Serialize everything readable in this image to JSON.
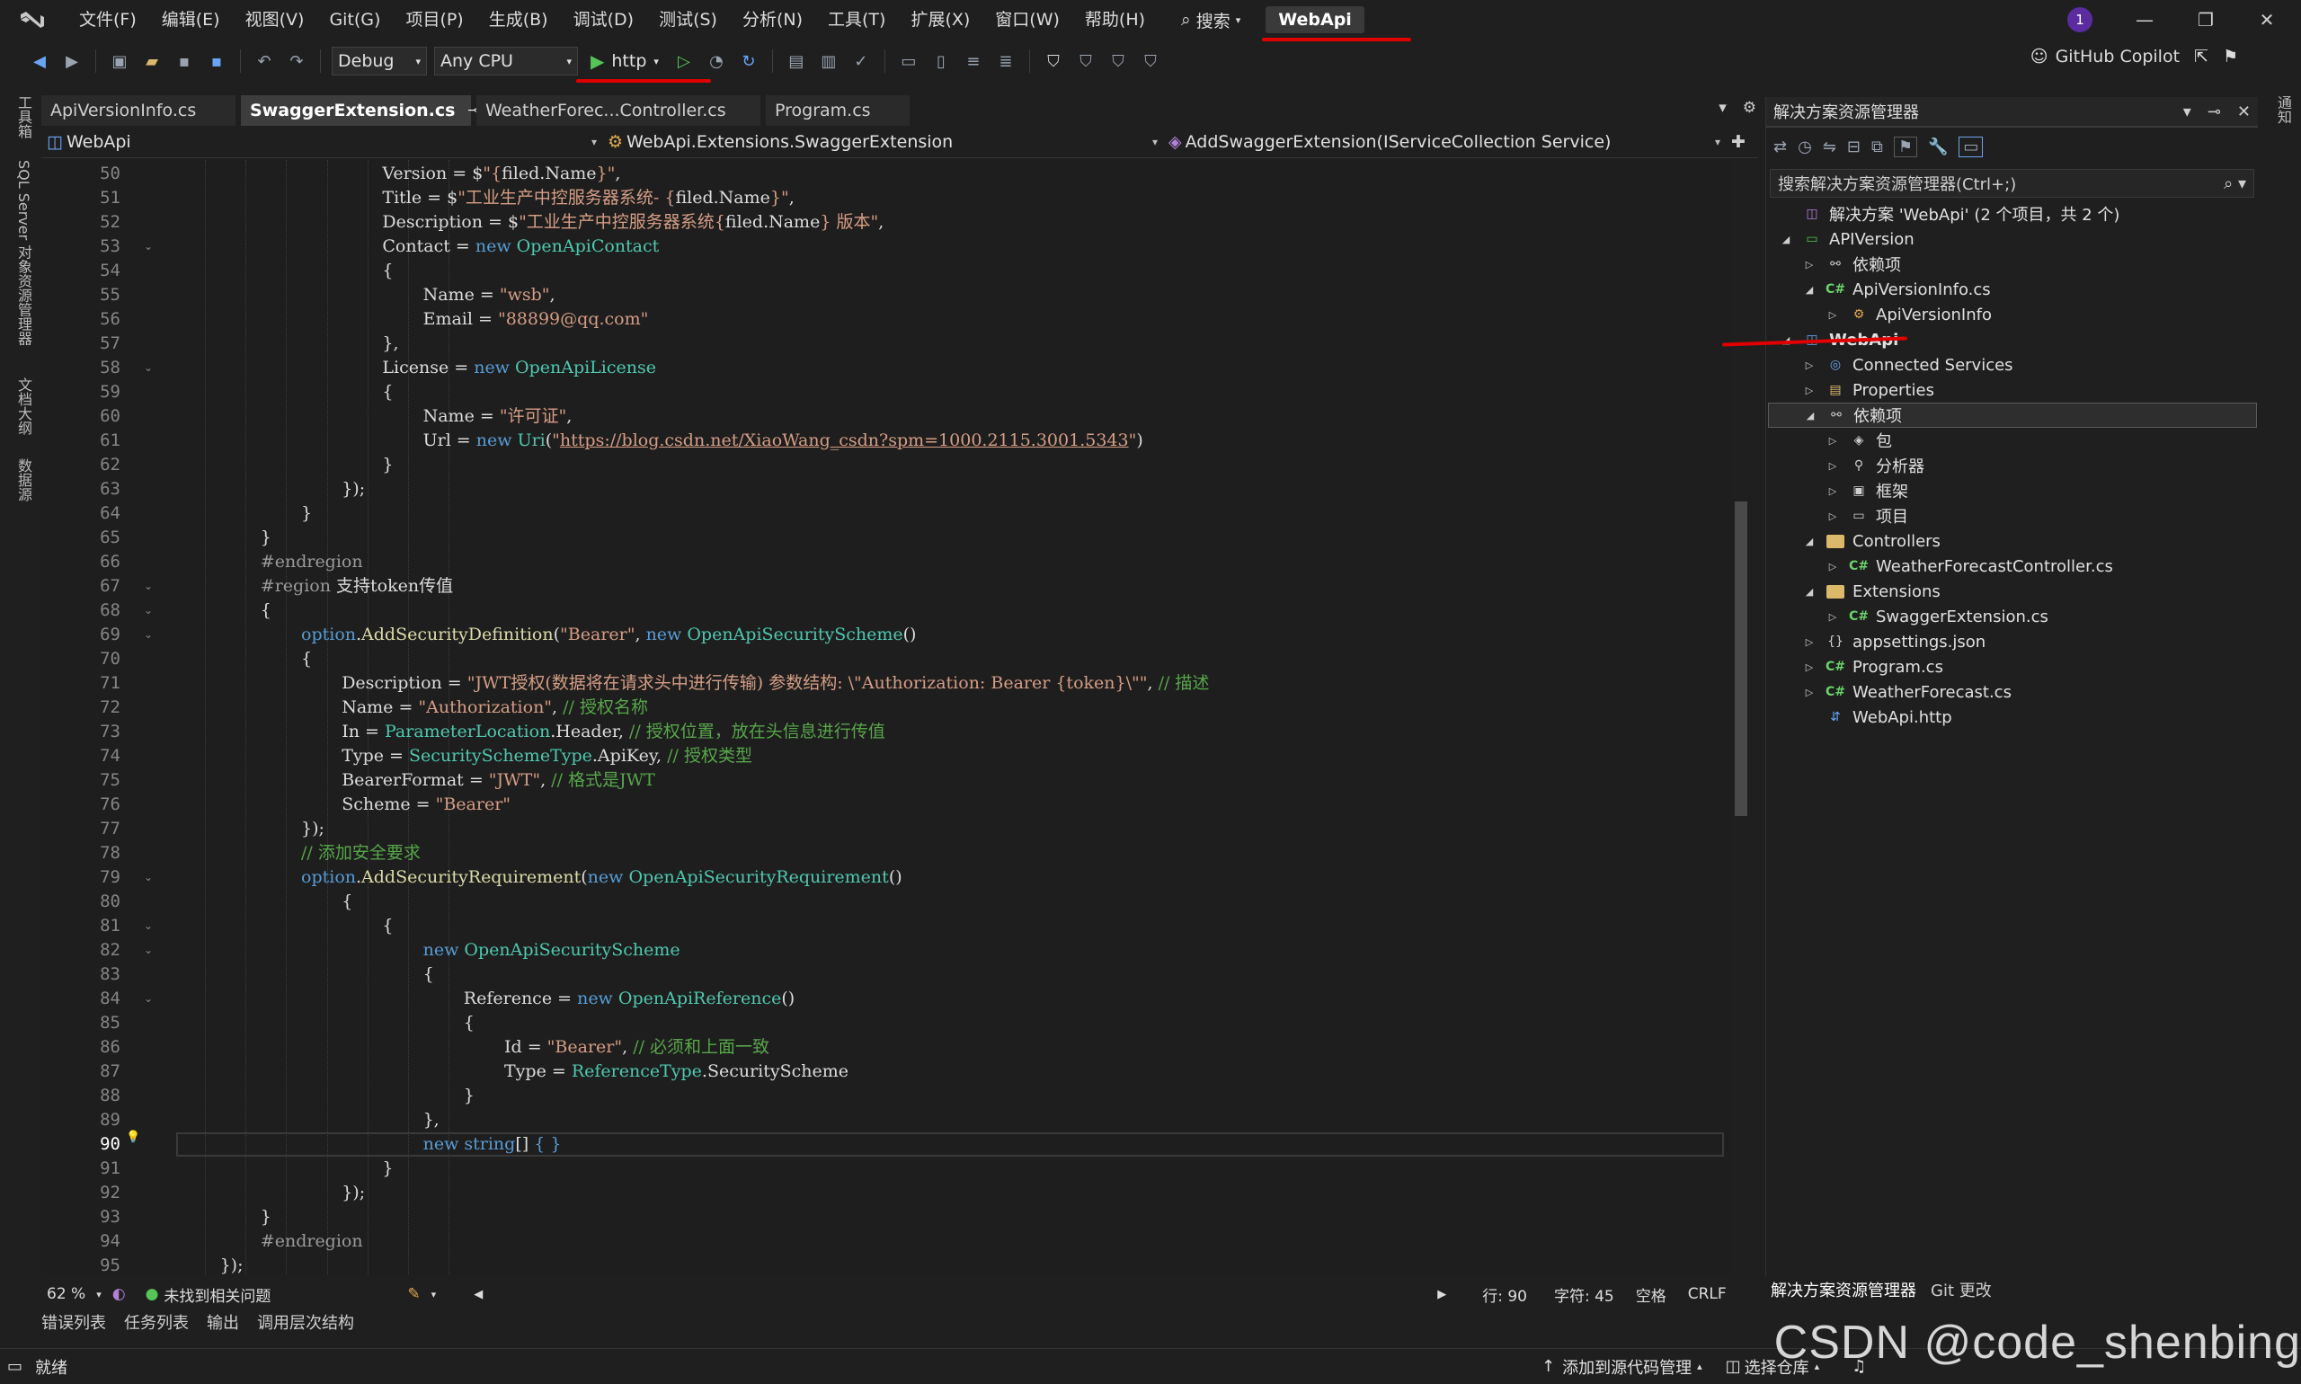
{
  "menu": {
    "items": [
      "文件(F)",
      "编辑(E)",
      "视图(V)",
      "Git(G)",
      "项目(P)",
      "生成(B)",
      "调试(D)",
      "测试(S)",
      "分析(N)",
      "工具(T)",
      "扩展(X)",
      "窗口(W)",
      "帮助(H)"
    ],
    "search_label": "搜索",
    "solution_title": "WebApi",
    "notification_count": "1"
  },
  "toolbar": {
    "config": "Debug",
    "platform": "Any CPU",
    "run_profile": "http",
    "copilot_label": "GitHub Copilot"
  },
  "left_strip": {
    "tabs": [
      "工具箱",
      "SQL Server 对象资源管理器",
      "文档大纲",
      "数据源"
    ]
  },
  "editor": {
    "tabs": [
      "ApiVersionInfo.cs",
      "SwaggerExtension.cs",
      "WeatherForec...Controller.cs",
      "Program.cs"
    ],
    "active_tab": 1,
    "nav": {
      "project": "WebApi",
      "type": "WebApi.Extensions.SwaggerExtension",
      "member": "AddSwaggerExtension(IServiceCollection Service)"
    },
    "current_line": 90,
    "lines": [
      {
        "n": 50,
        "indent": 9,
        "fold": false,
        "parts": [
          [
            "op",
            "Version = $"
          ],
          [
            "st",
            "\"{"
          ],
          [
            "op",
            "filed.Name"
          ],
          [
            "st",
            "}\""
          ],
          [
            "op",
            ","
          ]
        ]
      },
      {
        "n": 51,
        "indent": 9,
        "fold": false,
        "parts": [
          [
            "op",
            "Title = $"
          ],
          [
            "st",
            "\"工业生产中控服务器系统- {"
          ],
          [
            "op",
            "filed.Name"
          ],
          [
            "st",
            "}\""
          ],
          [
            "op",
            ","
          ]
        ]
      },
      {
        "n": 52,
        "indent": 9,
        "fold": false,
        "parts": [
          [
            "op",
            "Description = $"
          ],
          [
            "st",
            "\"工业生产中控服务器系统{"
          ],
          [
            "op",
            "filed.Name"
          ],
          [
            "st",
            "} 版本\""
          ],
          [
            "op",
            ","
          ]
        ]
      },
      {
        "n": 53,
        "indent": 9,
        "fold": true,
        "parts": [
          [
            "op",
            "Contact = "
          ],
          [
            "kw",
            "new "
          ],
          [
            "ty",
            "OpenApiContact"
          ]
        ]
      },
      {
        "n": 54,
        "indent": 9,
        "fold": false,
        "parts": [
          [
            "op",
            "{"
          ]
        ]
      },
      {
        "n": 55,
        "indent": 11,
        "fold": false,
        "parts": [
          [
            "op",
            "Name = "
          ],
          [
            "st",
            "\"wsb\""
          ],
          [
            "op",
            ","
          ]
        ]
      },
      {
        "n": 56,
        "indent": 11,
        "fold": false,
        "parts": [
          [
            "op",
            "Email = "
          ],
          [
            "st",
            "\"88899@qq.com\""
          ]
        ]
      },
      {
        "n": 57,
        "indent": 9,
        "fold": false,
        "parts": [
          [
            "op",
            "},"
          ]
        ]
      },
      {
        "n": 58,
        "indent": 9,
        "fold": true,
        "parts": [
          [
            "op",
            "License = "
          ],
          [
            "kw",
            "new "
          ],
          [
            "ty",
            "OpenApiLicense"
          ]
        ]
      },
      {
        "n": 59,
        "indent": 9,
        "fold": false,
        "parts": [
          [
            "op",
            "{"
          ]
        ]
      },
      {
        "n": 60,
        "indent": 11,
        "fold": false,
        "parts": [
          [
            "op",
            "Name = "
          ],
          [
            "st",
            "\"许可证\""
          ],
          [
            "op",
            ","
          ]
        ]
      },
      {
        "n": 61,
        "indent": 11,
        "fold": false,
        "parts": [
          [
            "op",
            "Url = "
          ],
          [
            "kw",
            "new "
          ],
          [
            "ty",
            "Uri"
          ],
          [
            "op",
            "("
          ],
          [
            "st",
            "\""
          ],
          [
            "lk",
            "https://blog.csdn.net/XiaoWang_csdn?spm=1000.2115.3001.5343"
          ],
          [
            "st",
            "\""
          ],
          [
            "op",
            ")"
          ]
        ]
      },
      {
        "n": 62,
        "indent": 9,
        "fold": false,
        "parts": [
          [
            "op",
            "}"
          ]
        ]
      },
      {
        "n": 63,
        "indent": 7,
        "fold": false,
        "parts": [
          [
            "op",
            "});"
          ]
        ]
      },
      {
        "n": 64,
        "indent": 5,
        "fold": false,
        "parts": [
          [
            "op",
            "}"
          ]
        ]
      },
      {
        "n": 65,
        "indent": 3,
        "fold": false,
        "parts": [
          [
            "op",
            "}"
          ]
        ]
      },
      {
        "n": 66,
        "indent": 3,
        "fold": false,
        "parts": [
          [
            "pp",
            "#endregion"
          ]
        ]
      },
      {
        "n": 67,
        "indent": 3,
        "fold": true,
        "parts": [
          [
            "pp",
            "#region "
          ],
          [
            "op",
            "支持token传值"
          ]
        ]
      },
      {
        "n": 68,
        "indent": 3,
        "fold": true,
        "parts": [
          [
            "op",
            "{"
          ]
        ]
      },
      {
        "n": 69,
        "indent": 5,
        "fold": true,
        "parts": [
          [
            "kw",
            "option"
          ],
          [
            "op",
            "."
          ],
          [
            "mt",
            "AddSecurityDefinition"
          ],
          [
            "op",
            "("
          ],
          [
            "st",
            "\"Bearer\""
          ],
          [
            "op",
            ", "
          ],
          [
            "kw",
            "new "
          ],
          [
            "ty",
            "OpenApiSecurityScheme"
          ],
          [
            "op",
            "()"
          ]
        ]
      },
      {
        "n": 70,
        "indent": 5,
        "fold": false,
        "parts": [
          [
            "op",
            "{"
          ]
        ]
      },
      {
        "n": 71,
        "indent": 7,
        "fold": false,
        "parts": [
          [
            "op",
            "Description = "
          ],
          [
            "st",
            "\"JWT授权(数据将在请求头中进行传输) 参数结构: \\\"Authorization: Bearer {token}\\\"\""
          ],
          [
            "op",
            ", "
          ],
          [
            "cm",
            "// 描述"
          ]
        ]
      },
      {
        "n": 72,
        "indent": 7,
        "fold": false,
        "parts": [
          [
            "op",
            "Name = "
          ],
          [
            "st",
            "\"Authorization\""
          ],
          [
            "op",
            ", "
          ],
          [
            "cm",
            "// 授权名称"
          ]
        ]
      },
      {
        "n": 73,
        "indent": 7,
        "fold": false,
        "parts": [
          [
            "op",
            "In = "
          ],
          [
            "ty",
            "ParameterLocation"
          ],
          [
            "op",
            ".Header, "
          ],
          [
            "cm",
            "// 授权位置，放在头信息进行传值"
          ]
        ]
      },
      {
        "n": 74,
        "indent": 7,
        "fold": false,
        "parts": [
          [
            "op",
            "Type = "
          ],
          [
            "ty",
            "SecuritySchemeType"
          ],
          [
            "op",
            ".ApiKey, "
          ],
          [
            "cm",
            "// 授权类型"
          ]
        ]
      },
      {
        "n": 75,
        "indent": 7,
        "fold": false,
        "parts": [
          [
            "op",
            "BearerFormat = "
          ],
          [
            "st",
            "\"JWT\""
          ],
          [
            "op",
            ", "
          ],
          [
            "cm",
            "// 格式是JWT"
          ]
        ]
      },
      {
        "n": 76,
        "indent": 7,
        "fold": false,
        "parts": [
          [
            "op",
            "Scheme = "
          ],
          [
            "st",
            "\"Bearer\""
          ]
        ]
      },
      {
        "n": 77,
        "indent": 5,
        "fold": false,
        "parts": [
          [
            "op",
            "});"
          ]
        ]
      },
      {
        "n": 78,
        "indent": 5,
        "fold": false,
        "parts": [
          [
            "cm",
            "// 添加安全要求"
          ]
        ]
      },
      {
        "n": 79,
        "indent": 5,
        "fold": true,
        "parts": [
          [
            "kw",
            "option"
          ],
          [
            "op",
            "."
          ],
          [
            "mt",
            "AddSecurityRequirement"
          ],
          [
            "op",
            "("
          ],
          [
            "kw",
            "new "
          ],
          [
            "ty",
            "OpenApiSecurityRequirement"
          ],
          [
            "op",
            "()"
          ]
        ]
      },
      {
        "n": 80,
        "indent": 7,
        "fold": false,
        "parts": [
          [
            "op",
            "{"
          ]
        ]
      },
      {
        "n": 81,
        "indent": 9,
        "fold": true,
        "parts": [
          [
            "op",
            "{"
          ]
        ]
      },
      {
        "n": 82,
        "indent": 11,
        "fold": true,
        "parts": [
          [
            "kw",
            "new "
          ],
          [
            "ty",
            "OpenApiSecurityScheme"
          ]
        ]
      },
      {
        "n": 83,
        "indent": 11,
        "fold": false,
        "parts": [
          [
            "op",
            "{"
          ]
        ]
      },
      {
        "n": 84,
        "indent": 13,
        "fold": true,
        "parts": [
          [
            "op",
            "Reference = "
          ],
          [
            "kw",
            "new "
          ],
          [
            "ty",
            "OpenApiReference"
          ],
          [
            "op",
            "()"
          ]
        ]
      },
      {
        "n": 85,
        "indent": 13,
        "fold": false,
        "parts": [
          [
            "op",
            "{"
          ]
        ]
      },
      {
        "n": 86,
        "indent": 15,
        "fold": false,
        "parts": [
          [
            "op",
            "Id = "
          ],
          [
            "st",
            "\"Bearer\""
          ],
          [
            "op",
            ", "
          ],
          [
            "cm",
            "// 必须和上面一致"
          ]
        ]
      },
      {
        "n": 87,
        "indent": 15,
        "fold": false,
        "parts": [
          [
            "op",
            "Type = "
          ],
          [
            "ty",
            "ReferenceType"
          ],
          [
            "op",
            ".SecurityScheme"
          ]
        ]
      },
      {
        "n": 88,
        "indent": 13,
        "fold": false,
        "parts": [
          [
            "op",
            "}"
          ]
        ]
      },
      {
        "n": 89,
        "indent": 11,
        "fold": false,
        "parts": [
          [
            "op",
            "},"
          ]
        ]
      },
      {
        "n": 90,
        "indent": 11,
        "fold": false,
        "parts": [
          [
            "kw",
            "new "
          ],
          [
            "kw",
            "string"
          ],
          [
            "op",
            "[] "
          ],
          [
            "kw",
            "{ }"
          ]
        ]
      },
      {
        "n": 91,
        "indent": 9,
        "fold": false,
        "parts": [
          [
            "op",
            "}"
          ]
        ]
      },
      {
        "n": 92,
        "indent": 7,
        "fold": false,
        "parts": [
          [
            "op",
            "});"
          ]
        ]
      },
      {
        "n": 93,
        "indent": 3,
        "fold": false,
        "parts": [
          [
            "op",
            "}"
          ]
        ]
      },
      {
        "n": 94,
        "indent": 3,
        "fold": false,
        "parts": [
          [
            "pp",
            "#endregion"
          ]
        ]
      },
      {
        "n": 95,
        "indent": 1,
        "fold": false,
        "parts": [
          [
            "op",
            "});"
          ]
        ]
      }
    ],
    "status": {
      "zoom": "62 %",
      "issues": "未找到相关问题",
      "line": "行: 90",
      "char": "字符: 45",
      "whitespace": "空格",
      "eol": "CRLF"
    }
  },
  "bottom_tabs": [
    "错误列表",
    "任务列表",
    "输出",
    "调用层次结构"
  ],
  "solution_explorer": {
    "title": "解决方案资源管理器",
    "search_placeholder": "搜索解决方案资源管理器(Ctrl+;)",
    "tree": [
      {
        "label": "解决方案 'WebApi' (2 个项目，共 2 个)",
        "level": 0,
        "arrow": "",
        "icon": "solution"
      },
      {
        "label": "APIVersion",
        "level": 0,
        "arrow": "open",
        "icon": "project"
      },
      {
        "label": "依赖项",
        "level": 1,
        "arrow": "closed",
        "icon": "deps"
      },
      {
        "label": "ApiVersionInfo.cs",
        "level": 1,
        "arrow": "open",
        "icon": "cs"
      },
      {
        "label": "ApiVersionInfo",
        "level": 2,
        "arrow": "closed",
        "icon": "class"
      },
      {
        "label": "WebApi",
        "level": 0,
        "arrow": "open",
        "icon": "web",
        "bold": true
      },
      {
        "label": "Connected Services",
        "level": 1,
        "arrow": "closed",
        "icon": "connected"
      },
      {
        "label": "Properties",
        "level": 1,
        "arrow": "closed",
        "icon": "props"
      },
      {
        "label": "依赖项",
        "level": 1,
        "arrow": "open",
        "icon": "deps",
        "selected": true
      },
      {
        "label": "包",
        "level": 2,
        "arrow": "closed",
        "icon": "pkg"
      },
      {
        "label": "分析器",
        "level": 2,
        "arrow": "closed",
        "icon": "analyzer"
      },
      {
        "label": "框架",
        "level": 2,
        "arrow": "closed",
        "icon": "framework"
      },
      {
        "label": "项目",
        "level": 2,
        "arrow": "closed",
        "icon": "projref"
      },
      {
        "label": "Controllers",
        "level": 1,
        "arrow": "open",
        "icon": "folder"
      },
      {
        "label": "WeatherForecastController.cs",
        "level": 2,
        "arrow": "closed",
        "icon": "cs"
      },
      {
        "label": "Extensions",
        "level": 1,
        "arrow": "open",
        "icon": "folder"
      },
      {
        "label": "SwaggerExtension.cs",
        "level": 2,
        "arrow": "closed",
        "icon": "cs"
      },
      {
        "label": "appsettings.json",
        "level": 1,
        "arrow": "closed",
        "icon": "json"
      },
      {
        "label": "Program.cs",
        "level": 1,
        "arrow": "closed",
        "icon": "cs"
      },
      {
        "label": "WeatherForecast.cs",
        "level": 1,
        "arrow": "closed",
        "icon": "cs"
      },
      {
        "label": "WebApi.http",
        "level": 1,
        "arrow": "",
        "icon": "http"
      }
    ],
    "bottom_tabs": [
      "解决方案资源管理器",
      "Git 更改"
    ]
  },
  "right_strip": {
    "tab": "通知"
  },
  "status_bar": {
    "ready": "就绪",
    "source_control": "添加到源代码管理",
    "repo": "选择仓库"
  },
  "watermark": "CSDN @code_shenbing"
}
